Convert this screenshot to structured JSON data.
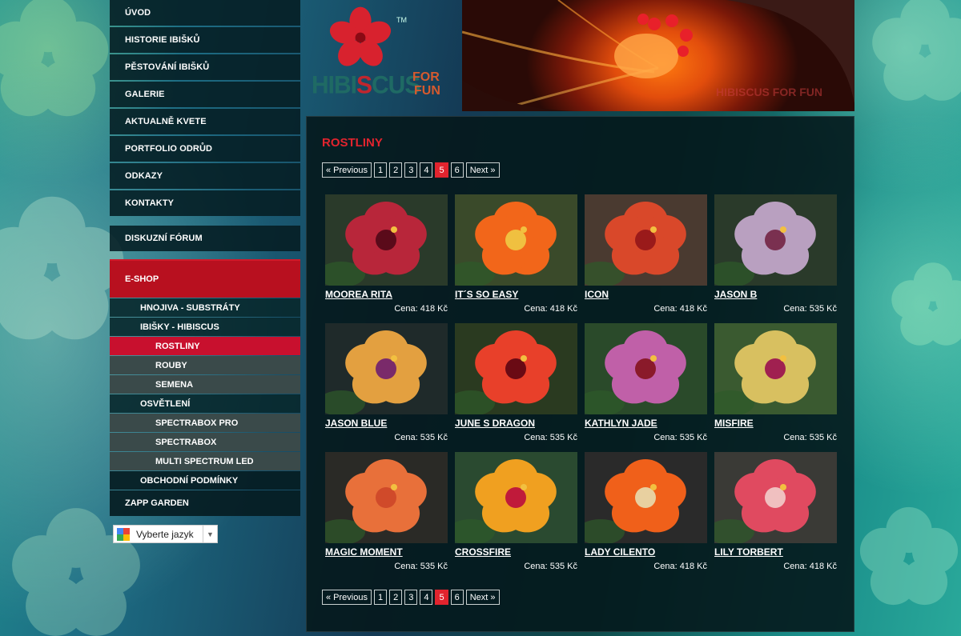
{
  "nav": {
    "items": [
      "ÚVOD",
      "HISTORIE IBIŠKŮ",
      "PĚSTOVÁNÍ IBIŠKŮ",
      "GALERIE",
      "AKTUALNĚ KVETE",
      "PORTFOLIO ODRŮD",
      "ODKAZY",
      "KONTAKTY"
    ],
    "forum": "DISKUZNÍ FÓRUM",
    "eshop": "E-SHOP",
    "sub": {
      "hnojiva": "HNOJIVA - SUBSTRÁTY",
      "ibisky": "IBIŠKY - HIBISCUS",
      "rostliny": "ROSTLINY",
      "rouby": "ROUBY",
      "semena": "SEMENA",
      "osvetleni": "OSVĚTLENÍ",
      "spectrabox_pro": "SPECTRABOX PRO",
      "spectrabox": "SPECTRABOX",
      "multi": "MULTI SPECTRUM LED",
      "podminky": "OBCHODNÍ PODMÍNKY"
    },
    "zapp": "ZAPP GARDEN"
  },
  "language": {
    "label": "Vyberte jazyk",
    "arrow": "▼"
  },
  "logo": {
    "text_hi": "HIBI",
    "text_s": "S",
    "text_cus": "CUS",
    "for": "FOR",
    "fun": "FUN",
    "tm": "TM"
  },
  "banner_watermark": "HIBISCUS FOR FUN",
  "page_title": "ROSTLINY",
  "pager": {
    "prev": "« Previous",
    "pages": [
      "1",
      "2",
      "3",
      "4",
      "5",
      "6"
    ],
    "current": "5",
    "next": "Next »"
  },
  "products": [
    {
      "name": "MOOREA RITA",
      "price": "Cena: 418 Kč",
      "petal": "#b8263a",
      "center": "#5a0a1a",
      "bg": "#2a3a2a"
    },
    {
      "name": "IT´S SO EASY",
      "price": "Cena: 418 Kč",
      "petal": "#f2661a",
      "center": "#f0c040",
      "bg": "#3a4a2a"
    },
    {
      "name": "ICON",
      "price": "Cena: 418 Kč",
      "petal": "#d9482a",
      "center": "#9a1a1a",
      "bg": "#4a3a30"
    },
    {
      "name": "JASON B",
      "price": "Cena: 535 Kč",
      "petal": "#b9a0c0",
      "center": "#7a3050",
      "bg": "#2a3a2a"
    },
    {
      "name": "JASON BLUE",
      "price": "Cena: 535 Kč",
      "petal": "#e3a040",
      "center": "#7a2a6a",
      "bg": "#1f2a2a"
    },
    {
      "name": "JUNE S DRAGON",
      "price": "Cena: 535 Kč",
      "petal": "#e8402a",
      "center": "#6a0a14",
      "bg": "#2a3a20"
    },
    {
      "name": "KATHLYN JADE",
      "price": "Cena: 535 Kč",
      "petal": "#c060a8",
      "center": "#8a1a2a",
      "bg": "#2a4a2a"
    },
    {
      "name": "MISFIRE",
      "price": "Cena: 535 Kč",
      "petal": "#d8c060",
      "center": "#a02050",
      "bg": "#3a5a30"
    },
    {
      "name": "MAGIC MOMENT",
      "price": "Cena: 535 Kč",
      "petal": "#e8703a",
      "center": "#d04a2a",
      "bg": "#2a2a26"
    },
    {
      "name": "CROSSFIRE",
      "price": "Cena: 535 Kč",
      "petal": "#f0a020",
      "center": "#c01a3a",
      "bg": "#2a4a30"
    },
    {
      "name": "LADY CILENTO",
      "price": "Cena: 418 Kč",
      "petal": "#f0601a",
      "center": "#e8d0a0",
      "bg": "#2a2a2a"
    },
    {
      "name": "LILY TORBERT",
      "price": "Cena: 418 Kč",
      "petal": "#e04a60",
      "center": "#f0c0c0",
      "bg": "#3a3a36"
    }
  ],
  "colors": {
    "accent": "#e2242e",
    "eshop": "#b8101f",
    "panel": "#04181c"
  }
}
